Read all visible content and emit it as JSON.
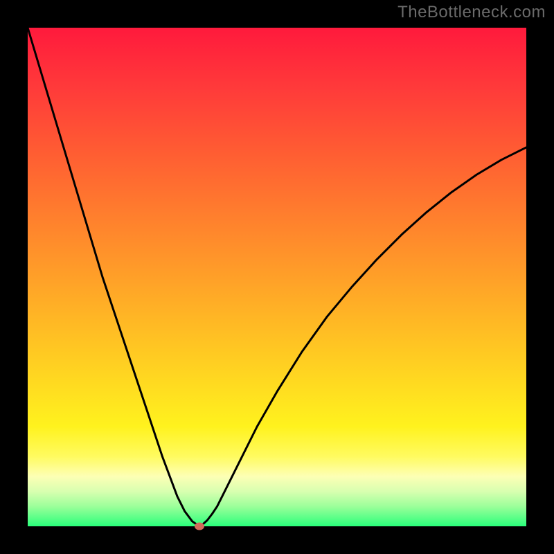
{
  "watermark": "TheBottleneck.com",
  "colors": {
    "frame": "#000000",
    "curve": "#000000",
    "marker": "#d36a5a"
  },
  "chart_data": {
    "type": "line",
    "title": "",
    "xlabel": "",
    "ylabel": "",
    "xlim": [
      0,
      100
    ],
    "ylim": [
      0,
      100
    ],
    "x": [
      0,
      3,
      6,
      9,
      12,
      15,
      18,
      21,
      24,
      27,
      30,
      31.5,
      33,
      34,
      34.5,
      35,
      36,
      37,
      38,
      40,
      43,
      46,
      50,
      55,
      60,
      65,
      70,
      75,
      80,
      85,
      90,
      95,
      100
    ],
    "values": [
      100,
      90,
      80,
      70,
      60,
      50,
      41,
      32,
      23,
      14,
      6,
      3,
      1,
      0.3,
      0,
      0.3,
      1.2,
      2.5,
      4,
      8,
      14,
      20,
      27,
      35,
      42,
      48,
      53.5,
      58.5,
      63,
      67,
      70.5,
      73.5,
      76
    ],
    "marker": {
      "x": 34.5,
      "y": 0
    },
    "notes": "y represents bottleneck percentage (0 at green bottom, 100 at red top); minimum at x≈34.5"
  }
}
